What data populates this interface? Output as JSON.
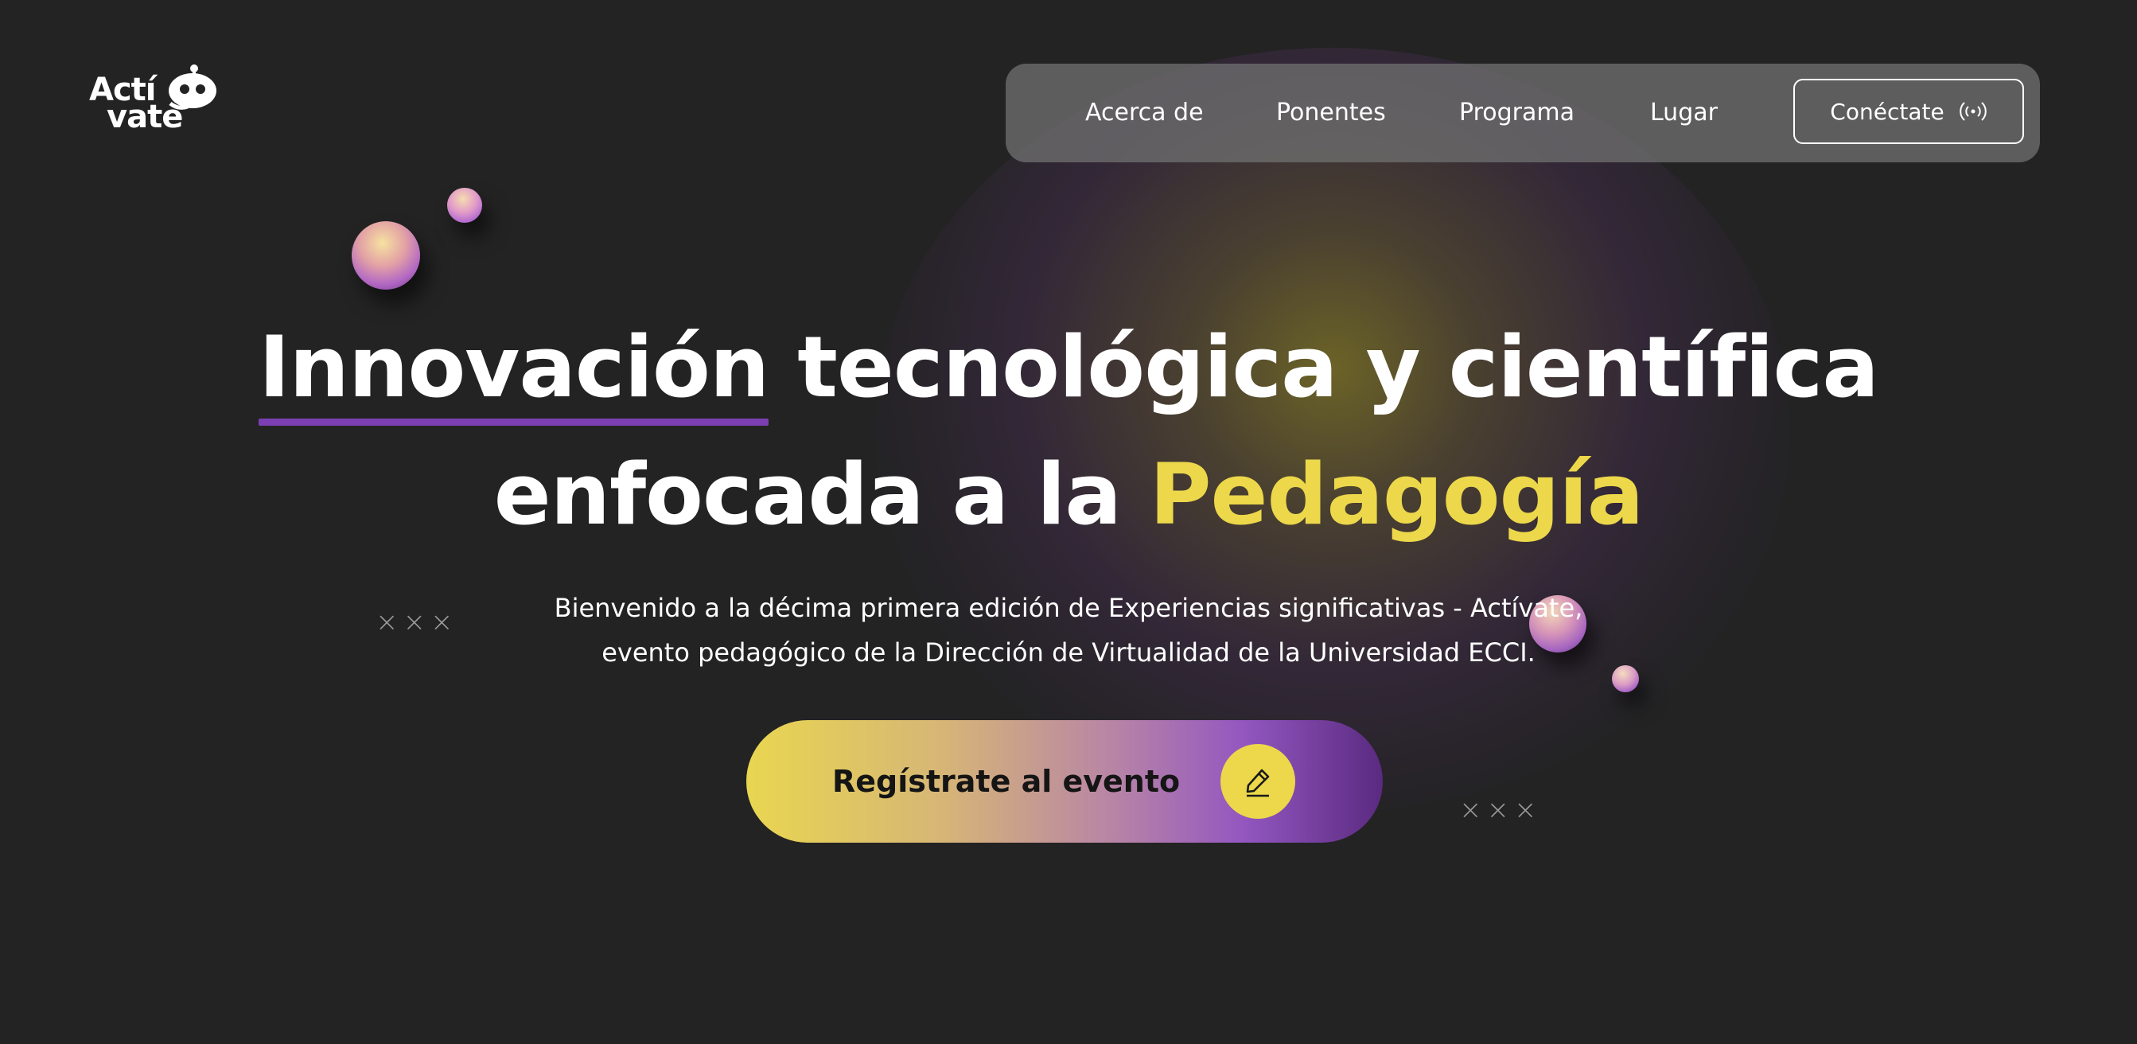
{
  "logo": {
    "line1": "Actí",
    "line2": "vate"
  },
  "nav": {
    "items": [
      {
        "label": "Acerca de"
      },
      {
        "label": "Ponentes"
      },
      {
        "label": "Programa"
      },
      {
        "label": "Lugar"
      }
    ],
    "connect_label": "Conéctate",
    "connect_icon": "broadcast-icon"
  },
  "hero": {
    "line1_underlined": "Innovación",
    "line1_rest": " tecnológica y científica",
    "line2_prefix": "enfocada a la ",
    "line2_highlight": "Pedagogía",
    "subtitle_line1": "Bienvenido a la décima primera edición de Experiencias significativas - Actívate,",
    "subtitle_line2": "evento pedagógico de la Dirección de Virtualidad de la Universidad ECCI."
  },
  "cta": {
    "label": "Regístrate al evento",
    "icon": "pencil-icon"
  },
  "decorations": {
    "xmarks_left": "×××",
    "xmarks_right": "×××"
  },
  "colors": {
    "background": "#232323",
    "accent_yellow": "#ecd84a",
    "accent_purple": "#7c3fb3",
    "nav_bg": "#6e6e6e"
  }
}
